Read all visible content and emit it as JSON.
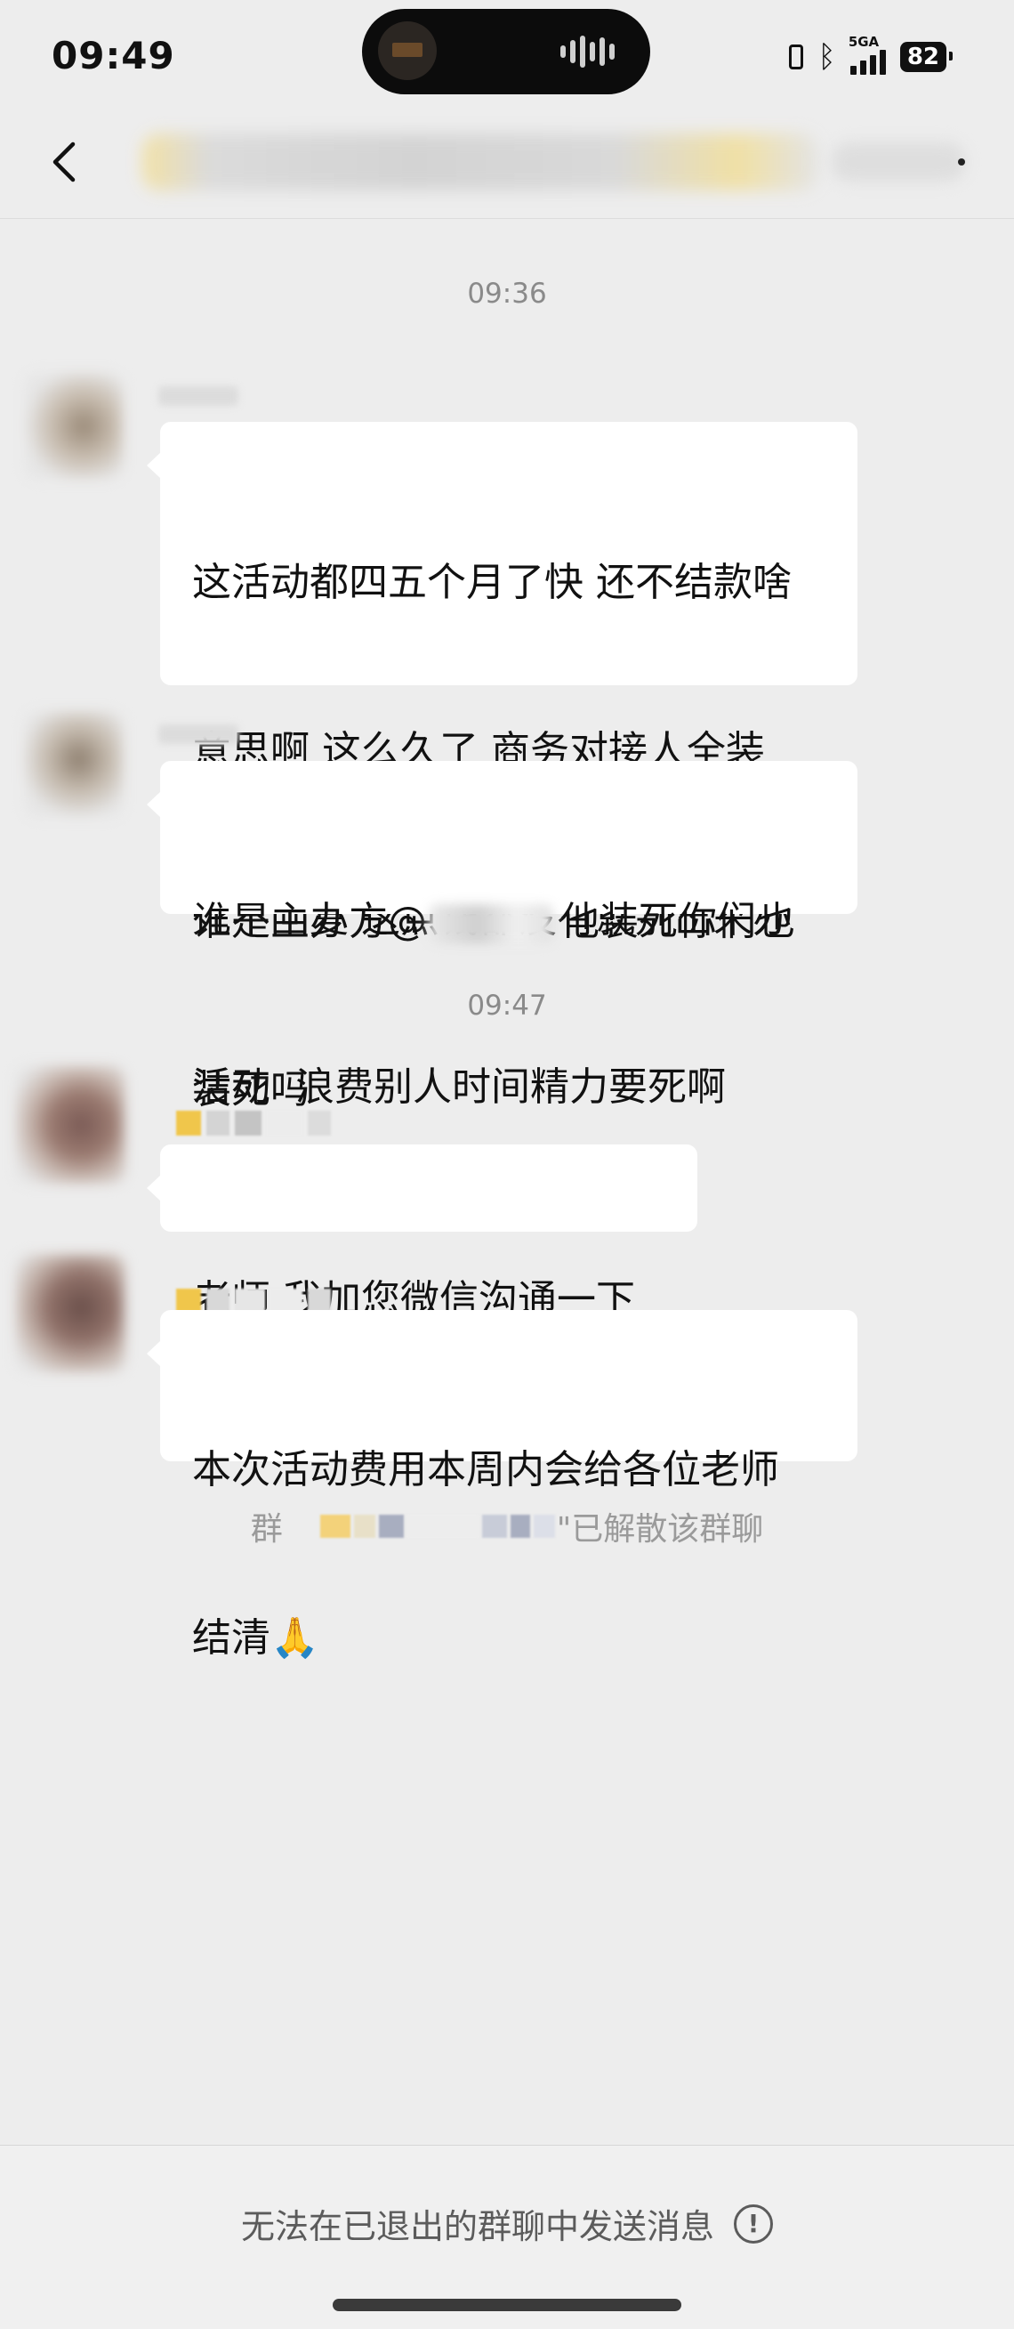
{
  "status_bar": {
    "time": "09:49",
    "network": "5GA",
    "battery": "82"
  },
  "chat": {
    "timestamps": [
      "09:36",
      "09:47"
    ],
    "messages": [
      {
        "lines": [
          "这活动都四五个月了快 还不结款啥",
          "意思啊 这么久了 商务对接人全装",
          "死不回复 这点钱都没有就别出来办",
          "活动  浪费别人时间精力要死啊"
        ]
      },
      {
        "line1_before": "谁是主办方@",
        "line1_after": "他装死你们也",
        "line2": "装死吗"
      },
      {
        "lines": [
          "老师 我加您微信沟通一下"
        ]
      },
      {
        "lines": [
          "本次活动费用本周内会给各位老师",
          "结清🙏"
        ]
      }
    ],
    "system_note": {
      "prefix": "群",
      "suffix": "\"已解散该群聊"
    }
  },
  "bottom_bar": {
    "text": "无法在已退出的群聊中发送消息",
    "info_glyph": "!"
  },
  "colors": {
    "background": "#ededed",
    "bubble": "#ffffff",
    "timestamp": "#8a8a8a",
    "accent_yellow": "#f0c64b"
  }
}
